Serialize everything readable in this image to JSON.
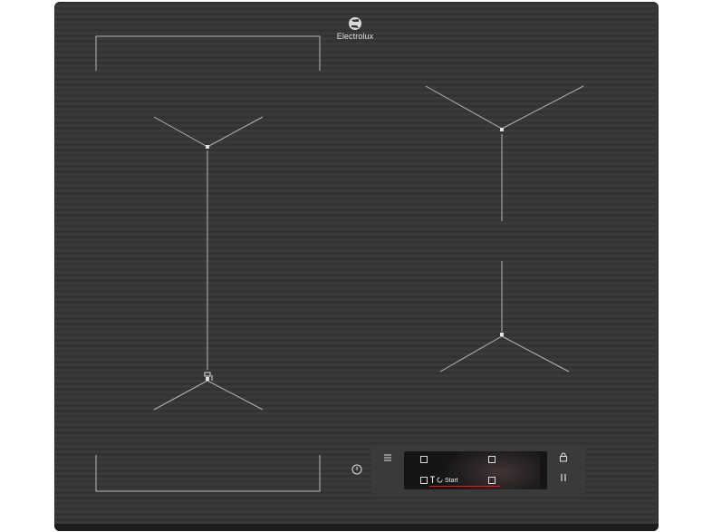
{
  "brand": {
    "name": "Electrolux"
  },
  "controls": {
    "start_label": "Start",
    "power_icon": "power-icon",
    "menu_icon": "menu-icon",
    "lock_icon": "lock-icon",
    "pause_icon": "pause-icon",
    "timer_icon": "timer-icon",
    "pot_icon": "pot-icon"
  },
  "colors": {
    "glass": "#363636",
    "lines": "#b5b5b5",
    "accent_line": "#a33a3a"
  }
}
